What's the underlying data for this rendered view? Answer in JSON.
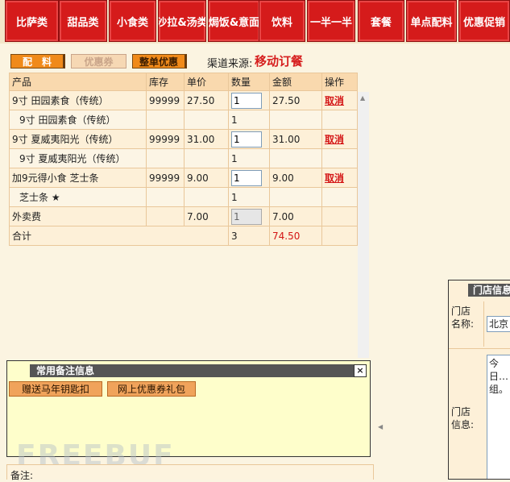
{
  "categories": [
    "比萨类",
    "甜品类",
    "小食类",
    "沙拉&汤类",
    "焗饭&意面",
    "饮料",
    "一半一半",
    "套餐",
    "单点配料",
    "优惠促销"
  ],
  "actions": {
    "peiliao": "配　料",
    "youhuiquan": "优惠券",
    "zhengdan": "整单优惠"
  },
  "source": {
    "label": "渠道来源:",
    "value": "移动订餐"
  },
  "table": {
    "headers": [
      "产品",
      "库存",
      "单价",
      "数量",
      "金额",
      "操作"
    ],
    "rows": [
      {
        "product": "9寸 田园素食（传统）",
        "stock": "99999",
        "price": "27.50",
        "qty": "1",
        "amount": "27.50",
        "op": "取消"
      },
      {
        "product": "9寸 田园素食（传统）",
        "qty": "1"
      },
      {
        "product": "9寸 夏威夷阳光（传统）",
        "stock": "99999",
        "price": "31.00",
        "qty": "1",
        "amount": "31.00",
        "op": "取消"
      },
      {
        "product": "9寸 夏威夷阳光（传统）",
        "qty": "1"
      },
      {
        "product": "加9元得小食 芝士条",
        "stock": "99999",
        "price": "9.00",
        "qty": "1",
        "amount": "9.00",
        "op": "取消"
      },
      {
        "product": "芝士条 ★",
        "qty": "1"
      },
      {
        "product": "外卖费",
        "price": "7.00",
        "qty": "1",
        "amount": "7.00"
      }
    ],
    "total": {
      "label": "合计",
      "qty": "3",
      "amount": "74.50"
    }
  },
  "notes_panel": {
    "title": "常用备注信息",
    "close": "×",
    "buttons": [
      "赠送马年钥匙扣",
      "网上优惠券礼包"
    ]
  },
  "remarks": {
    "label": "备注:"
  },
  "store_panel": {
    "title": "门店信息",
    "name_label": "门店名称:",
    "name_value": "北京",
    "info_label": "门店信息:",
    "info_value": "今日… 组。"
  },
  "watermark": "FREEBUF",
  "colors": {
    "category_red": "#d51b1b",
    "action_orange": "#f08a1a",
    "source_red": "#d61e1e",
    "panel_header": "#555555"
  }
}
